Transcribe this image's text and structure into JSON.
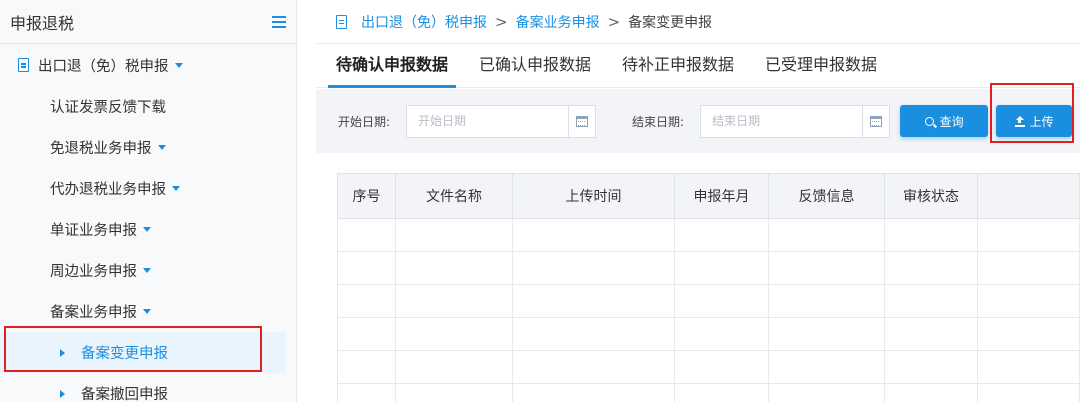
{
  "sidebar": {
    "title": "申报退税",
    "root": {
      "label": "出口退（免）税申报"
    },
    "items": [
      {
        "label": "认证发票反馈下载",
        "has_caret": false
      },
      {
        "label": "免退税业务申报",
        "has_caret": true
      },
      {
        "label": "代办退税业务申报",
        "has_caret": true
      },
      {
        "label": "单证业务申报",
        "has_caret": true
      },
      {
        "label": "周边业务申报",
        "has_caret": true
      },
      {
        "label": "备案业务申报",
        "has_caret": true
      }
    ],
    "sub_items": [
      {
        "label": "备案变更申报",
        "active": true
      },
      {
        "label": "备案撤回申报",
        "active": false
      }
    ]
  },
  "breadcrumb": {
    "items": [
      "出口退（免）税申报",
      "备案业务申报"
    ],
    "current": "备案变更申报",
    "separator": ">"
  },
  "tabs": [
    {
      "label": "待确认申报数据",
      "active": true
    },
    {
      "label": "已确认申报数据",
      "active": false
    },
    {
      "label": "待补正申报数据",
      "active": false
    },
    {
      "label": "已受理申报数据",
      "active": false
    }
  ],
  "filter": {
    "start_label": "开始日期:",
    "start_placeholder": "开始日期",
    "start_value": "",
    "end_label": "结束日期:",
    "end_placeholder": "结束日期",
    "end_value": "",
    "search_label": "查询",
    "upload_label": "上传"
  },
  "table": {
    "columns": [
      "序号",
      "文件名称",
      "上传时间",
      "申报年月",
      "反馈信息",
      "审核状态",
      ""
    ],
    "rows": [
      [
        "",
        "",
        "",
        "",
        "",
        "",
        ""
      ],
      [
        "",
        "",
        "",
        "",
        "",
        "",
        ""
      ],
      [
        "",
        "",
        "",
        "",
        "",
        "",
        ""
      ],
      [
        "",
        "",
        "",
        "",
        "",
        "",
        ""
      ],
      [
        "",
        "",
        "",
        "",
        "",
        "",
        ""
      ],
      [
        "",
        "",
        "",
        "",
        "",
        "",
        ""
      ]
    ]
  },
  "colors": {
    "accent": "#1a8fe0",
    "highlight_box": "#e02020",
    "sidebar_bg": "#f7f9fb",
    "filter_bg": "#f2f4f7"
  }
}
